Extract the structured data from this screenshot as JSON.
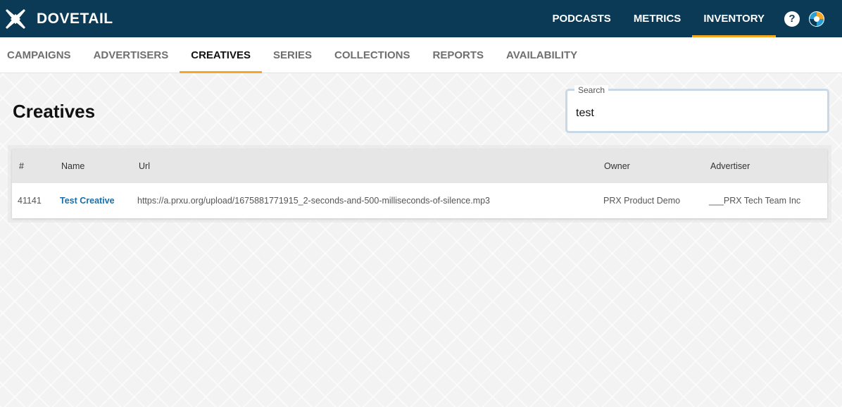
{
  "app": {
    "brand": "DOVETAIL",
    "nav": [
      {
        "label": "PODCASTS",
        "active": false
      },
      {
        "label": "METRICS",
        "active": false
      },
      {
        "label": "INVENTORY",
        "active": true
      }
    ],
    "help_symbol": "?",
    "colors": {
      "header": "#0b3a57",
      "accent": "#f5a623",
      "link": "#1a6ea8"
    }
  },
  "subnav": [
    {
      "label": "CAMPAIGNS",
      "active": false
    },
    {
      "label": "ADVERTISERS",
      "active": false
    },
    {
      "label": "CREATIVES",
      "active": true
    },
    {
      "label": "SERIES",
      "active": false
    },
    {
      "label": "COLLECTIONS",
      "active": false
    },
    {
      "label": "REPORTS",
      "active": false
    },
    {
      "label": "AVAILABILITY",
      "active": false
    }
  ],
  "page": {
    "title": "Creatives",
    "search": {
      "label": "Search",
      "value": "test "
    }
  },
  "table": {
    "columns": [
      "#",
      "Name",
      "Url",
      "Owner",
      "Advertiser"
    ],
    "rows": [
      {
        "id": "41141",
        "name": "Test Creative",
        "url": "https://a.prxu.org/upload/1675881771915_2-seconds-and-500-milliseconds-of-silence.mp3",
        "owner": "PRX Product Demo",
        "advertiser": "___PRX Tech Team Inc"
      }
    ]
  }
}
